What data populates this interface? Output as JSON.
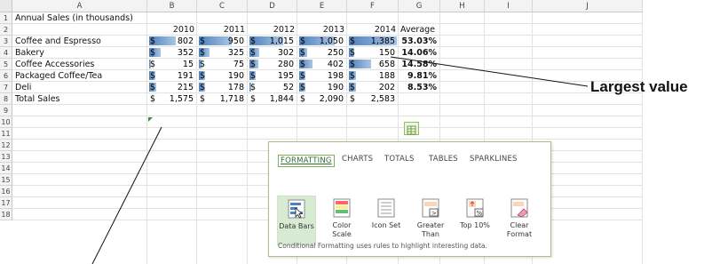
{
  "columns": [
    "A",
    "B",
    "C",
    "D",
    "E",
    "F",
    "G",
    "H",
    "I",
    "J"
  ],
  "rows": [
    "1",
    "2",
    "3",
    "4",
    "5",
    "6",
    "7",
    "8",
    "9",
    "10",
    "11",
    "12",
    "13",
    "14",
    "15",
    "16",
    "17",
    "18"
  ],
  "title": "Annual Sales (in thousands)",
  "years": [
    "2010",
    "2011",
    "2012",
    "2013",
    "2014"
  ],
  "average_header": "Average",
  "currency": "$",
  "data_rows": [
    {
      "label": "Coffee and Espresso",
      "values": [
        "802",
        "950",
        "1,015",
        "1,050",
        "1,385"
      ],
      "average": "53.03%"
    },
    {
      "label": "Bakery",
      "values": [
        "352",
        "325",
        "302",
        "250",
        "150"
      ],
      "average": "14.06%"
    },
    {
      "label": "Coffee Accessories",
      "values": [
        "15",
        "75",
        "280",
        "402",
        "658"
      ],
      "average": "14.58%"
    },
    {
      "label": "Packaged Coffee/Tea",
      "values": [
        "191",
        "190",
        "195",
        "198",
        "188"
      ],
      "average": "9.81%"
    },
    {
      "label": "Deli",
      "values": [
        "215",
        "178",
        "52",
        "190",
        "202"
      ],
      "average": "8.53%"
    }
  ],
  "data_bar_levels": [
    [
      0.58,
      0.69,
      0.73,
      0.76,
      1.0
    ],
    [
      0.25,
      0.23,
      0.22,
      0.18,
      0.11
    ],
    [
      0.01,
      0.05,
      0.2,
      0.29,
      0.47
    ],
    [
      0.14,
      0.14,
      0.14,
      0.14,
      0.14
    ],
    [
      0.16,
      0.13,
      0.04,
      0.14,
      0.15
    ]
  ],
  "total_row": {
    "label": "Total Sales",
    "values": [
      "1,575",
      "1,718",
      "1,844",
      "2,090",
      "2,583"
    ]
  },
  "quick_analysis": {
    "tabs": [
      "FORMATTING",
      "CHARTS",
      "TOTALS",
      "TABLES",
      "SPARKLINES"
    ],
    "active_tab": "FORMATTING",
    "options": [
      {
        "icon": "data-bars-icon",
        "label": "Data Bars"
      },
      {
        "icon": "color-scale-icon",
        "label": "Color\nScale"
      },
      {
        "icon": "icon-set-icon",
        "label": "Icon Set"
      },
      {
        "icon": "greater-than-icon",
        "label": "Greater\nThan"
      },
      {
        "icon": "top-10-icon",
        "label": "Top 10%"
      },
      {
        "icon": "clear-format-icon",
        "label": "Clear\nFormat"
      }
    ],
    "footer": "Conditional Formatting uses rules to highlight interesting data."
  },
  "callout": "Largest value",
  "colors": {
    "bar": "#4f81bd",
    "panel_border": "#a6c18d",
    "tab_active": "#2e6b2e"
  }
}
